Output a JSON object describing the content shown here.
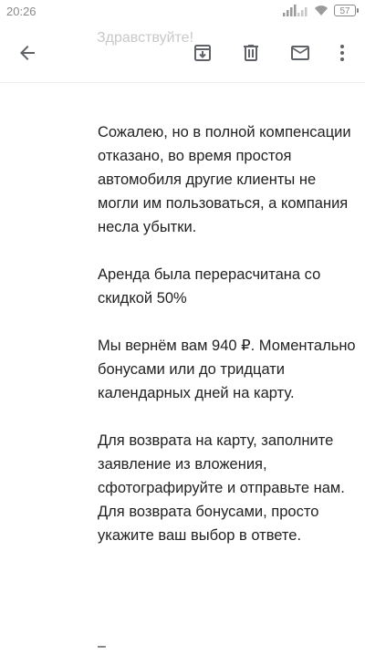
{
  "status_bar": {
    "time": "20:26",
    "battery": "57"
  },
  "app_bar": {
    "faded_subject": "Здравствуйте!",
    "icons": {
      "back": "arrow-back-icon",
      "archive": "archive-icon",
      "delete": "trash-icon",
      "mark_unread": "mail-icon",
      "more": "more-vert-icon"
    }
  },
  "email_body": {
    "paragraphs": [
      "Сожалею, но в полной компенсации отказано, во время простоя автомобиля другие клиенты не могли им пользоваться, а компания несла убытки.",
      "Аренда была перерасчитана со скидкой  50%",
      "Мы вернём вам 940 ₽. Моментально бонусами или до тридцати календарных дней на карту.",
      "Для возврата на карту, заполните заявление из вложения, сфотографируйте и отправьте нам.\nДля возврата бонусами, просто укажите ваш выбор в ответе."
    ],
    "trailing": "–"
  },
  "colors": {
    "icon": "#5f6368",
    "text": "#222222",
    "faded": "#c8c8c8"
  }
}
